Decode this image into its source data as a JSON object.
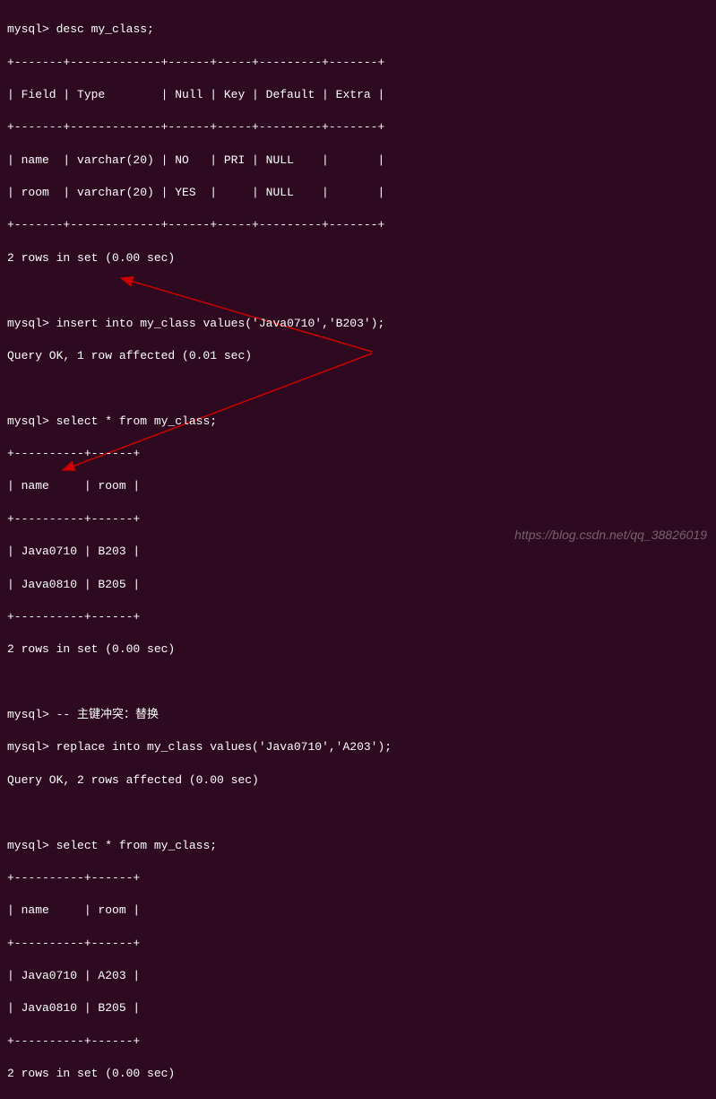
{
  "prompt": "mysql>",
  "commands": {
    "desc": "desc my_class;",
    "insert": "insert into my_class values('Java0710','B203');",
    "select1": "select * from my_class;",
    "comment": "-- 主键冲突：替换",
    "replace": "replace into my_class values('Java0710','A203');",
    "select2": "select * from my_class;"
  },
  "desc_table": {
    "border_top": "+-------+-------------+------+-----+---------+-------+",
    "header": "| Field | Type        | Null | Key | Default | Extra |",
    "border_mid": "+-------+-------------+------+-----+---------+-------+",
    "row1": "| name  | varchar(20) | NO   | PRI | NULL    |       |",
    "row2": "| room  | varchar(20) | YES  |     | NULL    |       |",
    "border_bot": "+-------+-------------+------+-----+---------+-------+",
    "footer": "2 rows in set (0.00 sec)"
  },
  "insert_result": "Query OK, 1 row affected (0.01 sec)",
  "select1_table": {
    "border_top": "+----------+------+",
    "header": "| name     | room |",
    "border_mid": "+----------+------+",
    "row1": "| Java0710 | B203 |",
    "row2": "| Java0810 | B205 |",
    "border_bot": "+----------+------+",
    "footer": "2 rows in set (0.00 sec)"
  },
  "replace_result": "Query OK, 2 rows affected (0.00 sec)",
  "select2_table": {
    "border_top": "+----------+------+",
    "header": "| name     | room |",
    "border_mid": "+----------+------+",
    "row1": "| Java0710 | A203 |",
    "row2": "| Java0810 | B205 |",
    "border_bot": "+----------+------+",
    "footer": "2 rows in set (0.00 sec)"
  },
  "watermark": "https://blog.csdn.net/qq_38826019",
  "arrow_color": "#cc0000"
}
